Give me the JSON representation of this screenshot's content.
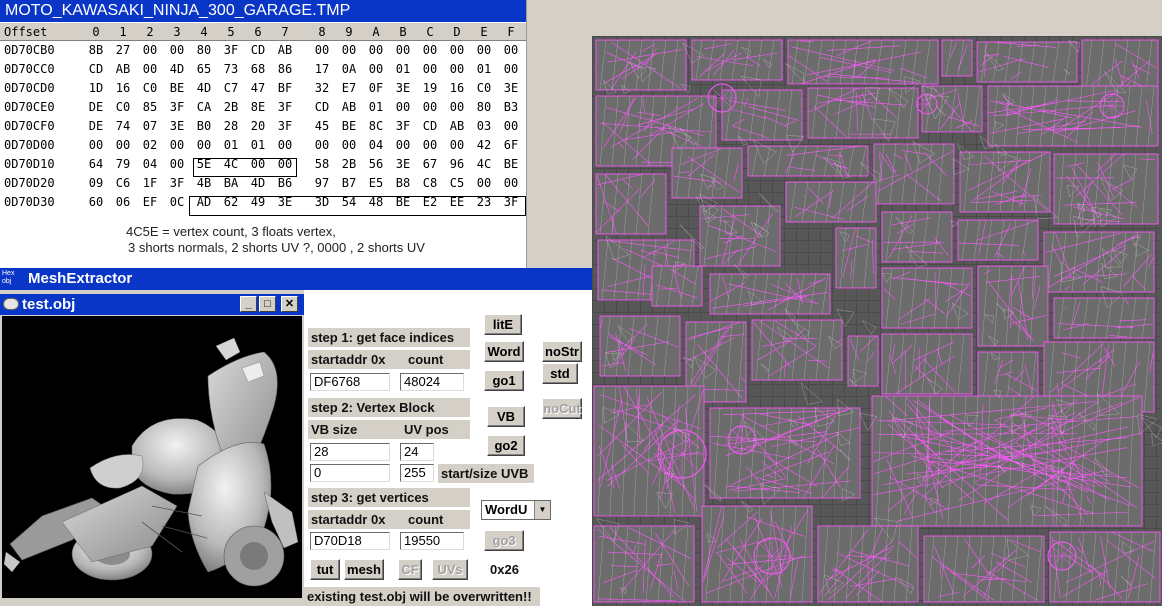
{
  "hex": {
    "title": "MOTO_KAWASAKI_NINJA_300_GARAGE.TMP",
    "offset_header": "Offset",
    "columns": [
      "0",
      "1",
      "2",
      "3",
      "4",
      "5",
      "6",
      "7",
      "8",
      "9",
      "A",
      "B",
      "C",
      "D",
      "E",
      "F"
    ],
    "rows": [
      {
        "offset": "0D70CB0",
        "bytes": [
          "8B",
          "27",
          "00",
          "00",
          "80",
          "3F",
          "CD",
          "AB",
          "00",
          "00",
          "00",
          "00",
          "00",
          "00",
          "00",
          "00"
        ]
      },
      {
        "offset": "0D70CC0",
        "bytes": [
          "CD",
          "AB",
          "00",
          "4D",
          "65",
          "73",
          "68",
          "86",
          "17",
          "0A",
          "00",
          "01",
          "00",
          "00",
          "01",
          "00"
        ]
      },
      {
        "offset": "0D70CD0",
        "bytes": [
          "1D",
          "16",
          "C0",
          "BE",
          "4D",
          "C7",
          "47",
          "BF",
          "32",
          "E7",
          "0F",
          "3E",
          "19",
          "16",
          "C0",
          "3E"
        ]
      },
      {
        "offset": "0D70CE0",
        "bytes": [
          "DE",
          "C0",
          "85",
          "3F",
          "CA",
          "2B",
          "8E",
          "3F",
          "CD",
          "AB",
          "01",
          "00",
          "00",
          "00",
          "80",
          "B3"
        ]
      },
      {
        "offset": "0D70CF0",
        "bytes": [
          "DE",
          "74",
          "07",
          "3E",
          "B0",
          "28",
          "20",
          "3F",
          "45",
          "BE",
          "8C",
          "3F",
          "CD",
          "AB",
          "03",
          "00"
        ]
      },
      {
        "offset": "0D70D00",
        "bytes": [
          "00",
          "00",
          "02",
          "00",
          "00",
          "01",
          "01",
          "00",
          "00",
          "00",
          "04",
          "00",
          "00",
          "00",
          "42",
          "6F"
        ]
      },
      {
        "offset": "0D70D10",
        "bytes": [
          "64",
          "79",
          "04",
          "00",
          "5E",
          "4C",
          "00",
          "00",
          "58",
          "2B",
          "56",
          "3E",
          "67",
          "96",
          "4C",
          "BE"
        ]
      },
      {
        "offset": "0D70D20",
        "bytes": [
          "09",
          "C6",
          "1F",
          "3F",
          "4B",
          "BA",
          "4D",
          "B6",
          "97",
          "B7",
          "E5",
          "B8",
          "C8",
          "C5",
          "00",
          "00"
        ]
      },
      {
        "offset": "0D70D30",
        "bytes": [
          "60",
          "06",
          "EF",
          "0C",
          "AD",
          "62",
          "49",
          "3E",
          "3D",
          "54",
          "48",
          "BE",
          "E2",
          "EE",
          "23",
          "3F"
        ]
      }
    ],
    "note_line1": "4C5E = vertex count,  3 floats vertex,",
    "note_line2": "3 shorts normals, 2 shorts UV ?, 0000 , 2 shorts UV"
  },
  "mesh_extractor": {
    "icon_text": "Hex obj",
    "title": "MeshExtractor",
    "step1_label": "step 1: get face indices",
    "startaddr_label": "startaddr 0x",
    "count_label": "count",
    "face_start": "DF6768",
    "face_count": "48024",
    "btn_lite": "litE",
    "btn_word": "Word",
    "btn_nostr": "noStr",
    "btn_std": "std",
    "btn_go1": "go1",
    "step2_label": "step 2: Vertex Block",
    "vbsize_label": "VB size",
    "uvpos_label": "UV pos",
    "vb_size": "28",
    "uv_pos": "24",
    "uvb_start": "0",
    "uvb_size": "255",
    "uvb_label": "start/size UVB",
    "btn_vb": "VB",
    "btn_nocut": "noCut",
    "btn_go2": "go2",
    "step3_label": "step 3: get vertices",
    "startaddr_label2": "startaddr 0x",
    "count_label2": "count",
    "vert_start": "D70D18",
    "vert_count": "19550",
    "combo_value": "WordU",
    "btn_go3": "go3",
    "btn_tut": "tut",
    "btn_mesh": "mesh",
    "btn_cf": "CF",
    "btn_uvs": "UVs",
    "hex_stride": "0x26",
    "warning": "existing test.obj will be overwritten!!"
  },
  "obj_window": {
    "title": "test.obj",
    "min_label": "_",
    "max_label": "□",
    "close_label": "✕"
  },
  "colors": {
    "titlebar": "#0a36c8",
    "wireframe": "#ff55ff",
    "uv_background": "#575757",
    "mesh_gray": "#bdbdbd"
  }
}
